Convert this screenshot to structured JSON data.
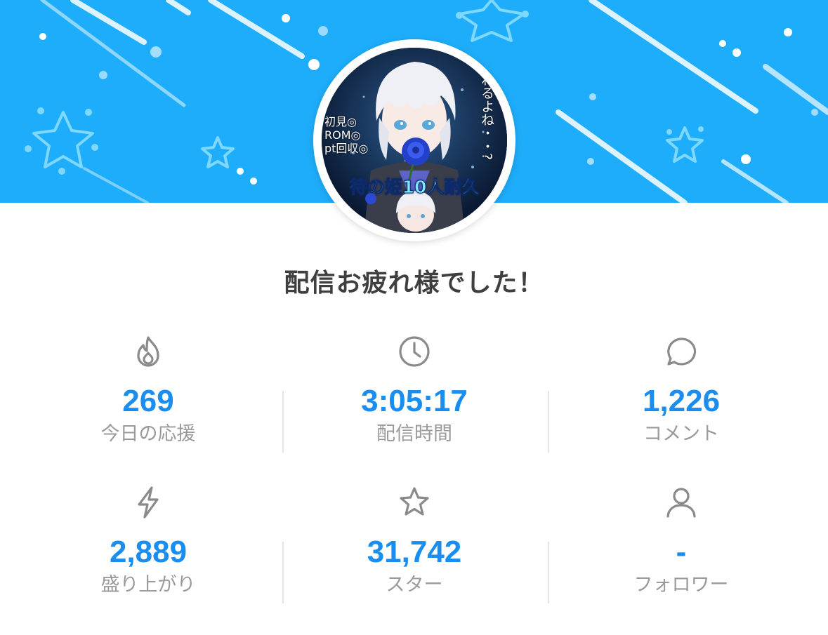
{
  "banner": {
    "background_color": "#1eadfa",
    "avatar": {
      "left_text": [
        "初見◎",
        "ROM◎",
        "pt回収◎"
      ],
      "vertical_text": "わるよね・・?",
      "banner_text": "待の姫10人耐久"
    }
  },
  "headline": "配信お疲れ様でした！",
  "stats": [
    {
      "icon": "flame-icon",
      "value": "269",
      "label": "今日の応援"
    },
    {
      "icon": "clock-icon",
      "value": "3:05:17",
      "label": "配信時間"
    },
    {
      "icon": "comment-bubble-icon",
      "value": "1,226",
      "label": "コメント"
    },
    {
      "icon": "lightning-icon",
      "value": "2,889",
      "label": "盛り上がり"
    },
    {
      "icon": "star-icon",
      "value": "31,742",
      "label": "スター"
    },
    {
      "icon": "person-icon",
      "value": "-",
      "label": "フォロワー"
    }
  ],
  "colors": {
    "value": "#1a8ef0",
    "label": "#9a9a9a",
    "icon": "#8a8a8a",
    "headline": "#3f3f3f"
  }
}
